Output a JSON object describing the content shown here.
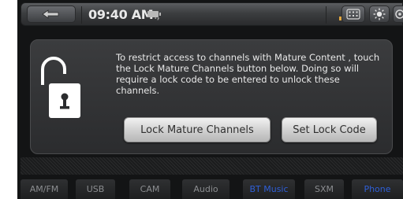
{
  "status_bar": {
    "time": "09:40 AM",
    "time_suffix": ".,"
  },
  "dialog": {
    "message": "To restrict access to channels with Mature Content , touch the Lock Mature Channels button below. Doing so will require a lock code to be entered to unlock these channels.",
    "lock_button_label": "Lock Mature Channels",
    "set_code_button_label": "Set Lock Code"
  },
  "nav": {
    "tabs": [
      {
        "label": "AM/FM"
      },
      {
        "label": "USB"
      },
      {
        "label": "CAM"
      },
      {
        "label": "Audio"
      },
      {
        "label": "BT Music"
      },
      {
        "label": "SXM"
      },
      {
        "label": "Phone"
      }
    ]
  },
  "colors": {
    "background": "#131415",
    "dialog": "#333436",
    "button": "#d9d9d9",
    "nav_active": "#2f5fd6"
  }
}
